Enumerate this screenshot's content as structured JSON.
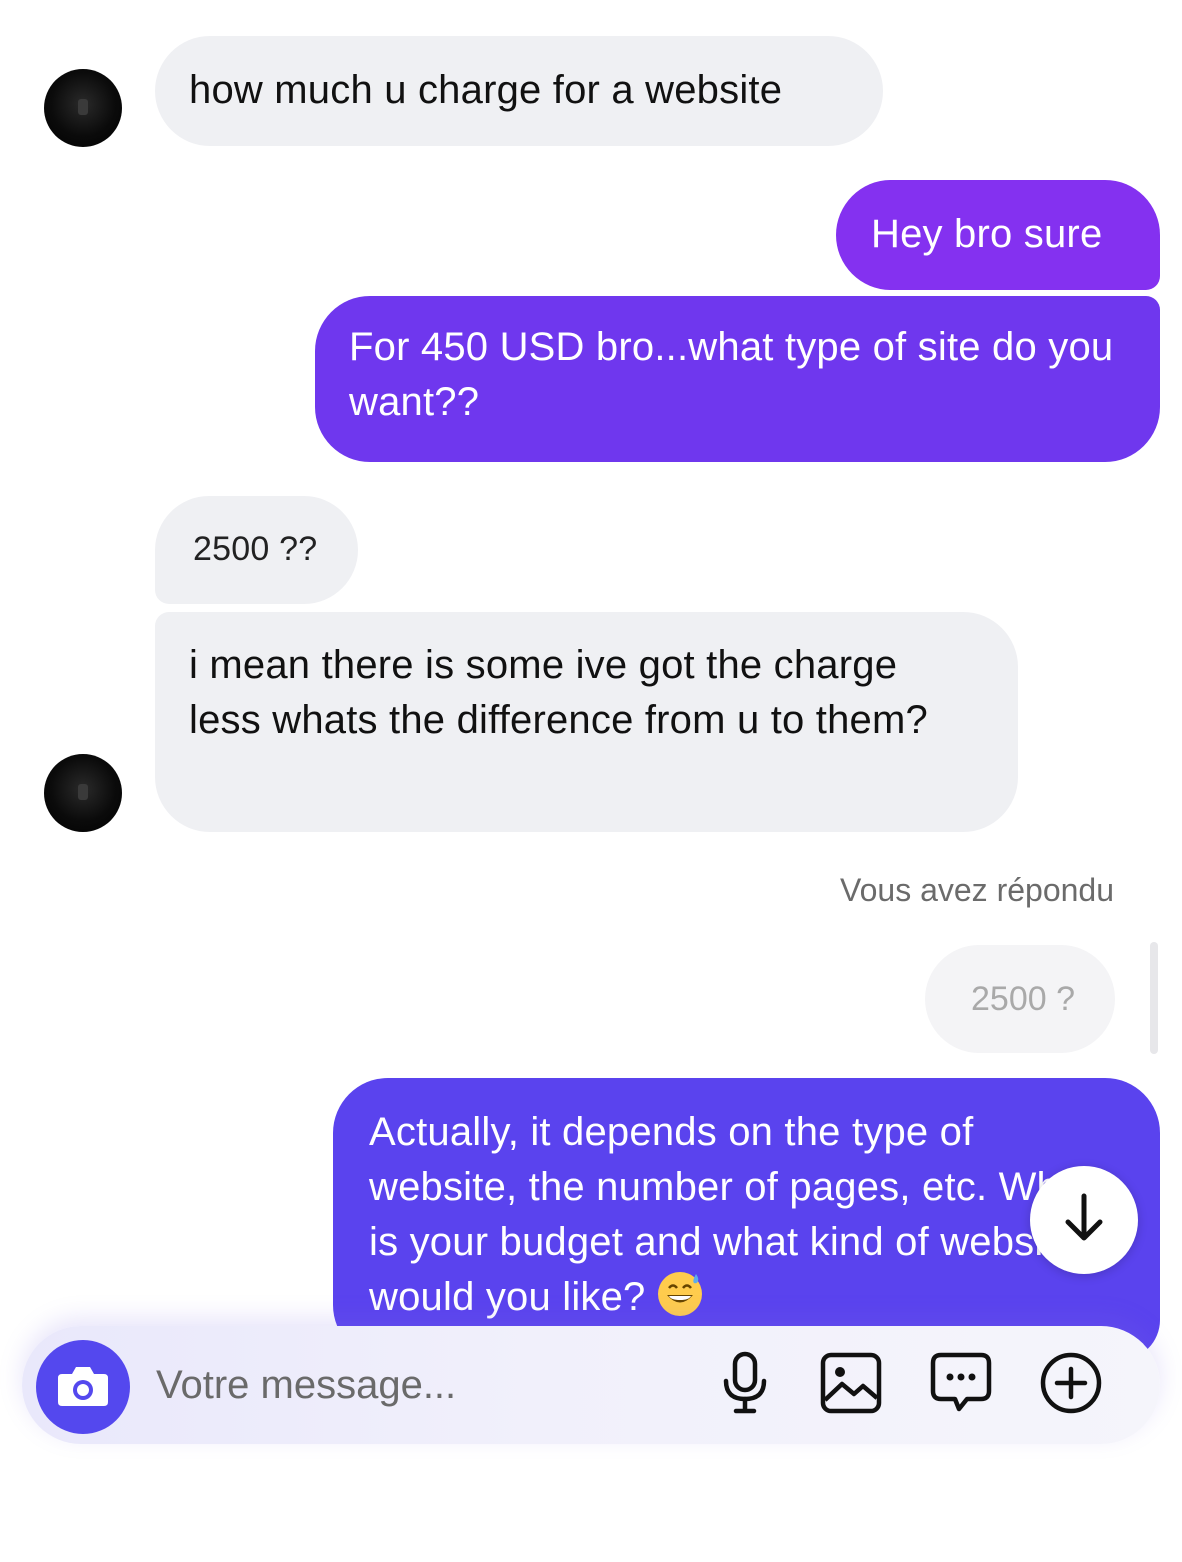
{
  "thread": {
    "messages": [
      {
        "sender": "contact",
        "text": "how much u charge for a website"
      },
      {
        "sender": "me",
        "text": "Hey bro sure"
      },
      {
        "sender": "me",
        "text": "For 450 USD bro...what type of site do you want??"
      },
      {
        "sender": "contact",
        "text": "2500 ??"
      },
      {
        "sender": "contact",
        "text": "i mean there is some ive got the charge less whats the difference from u to them?"
      }
    ],
    "reply_label": "Vous avez répondu",
    "quoted_text": "2500 ?",
    "reply_message": {
      "sender": "me",
      "text": "Actually, it depends on the type of website, the number of pages, etc. What is your budget and what kind of website would you like?",
      "emoji": "grinning-face-with-sweat"
    }
  },
  "composer": {
    "placeholder": "Votre message..."
  },
  "icons": {
    "camera": "camera-icon",
    "microphone": "microphone-icon",
    "gallery": "image-icon",
    "stickers": "chat-bubble-dots-icon",
    "more": "plus-circle-icon",
    "scroll_down": "arrow-down-icon"
  },
  "colors": {
    "incoming_bubble": "#eff0f3",
    "outgoing_gradient": [
      "#8431f0",
      "#6f37ee",
      "#5a43ee"
    ],
    "accent": "#5448ee"
  }
}
